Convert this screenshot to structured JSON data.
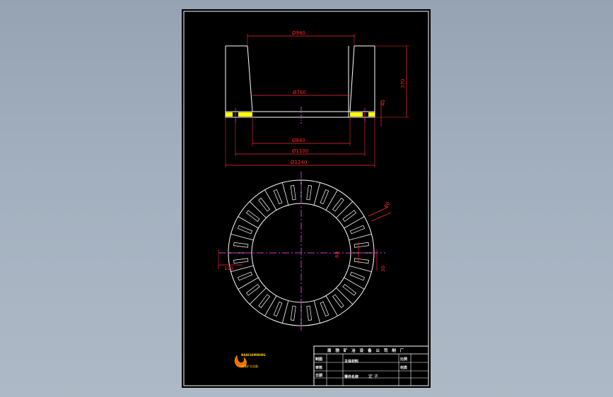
{
  "drawing": {
    "dimensions": {
      "top_outer_diameter": "Ø980",
      "inner_diameter": "Ø760",
      "height_total": "370",
      "base_thickness": "40",
      "bottom_inner_diameter": "Ø840",
      "bottom_mid_diameter": "Ø1100",
      "bottom_outer_diameter": "Ø1240",
      "plan_slot_width": "80",
      "plan_slot_depth": "60",
      "plan_slot_gap": "30",
      "plan_left_dim": "100"
    },
    "colors": {
      "sheet": "#000000",
      "outline": "#ffffff",
      "dimension": "#ff2a2a",
      "centerline": "#d633d6",
      "fill_marker": "#ffff00"
    }
  },
  "title_block": {
    "company": "南 驰 矿 冶 设 备 公 司 制 厂",
    "rows_left": [
      "制图",
      "审核",
      "日期"
    ],
    "material_label": "主体材料",
    "part_name_label": "零件名称",
    "part_name": "定 子",
    "ratio_label": "比例",
    "material_short": "材质"
  },
  "logo": {
    "text_top": "NANCHIMINING",
    "text_bottom": "南驰矿冶设备"
  }
}
